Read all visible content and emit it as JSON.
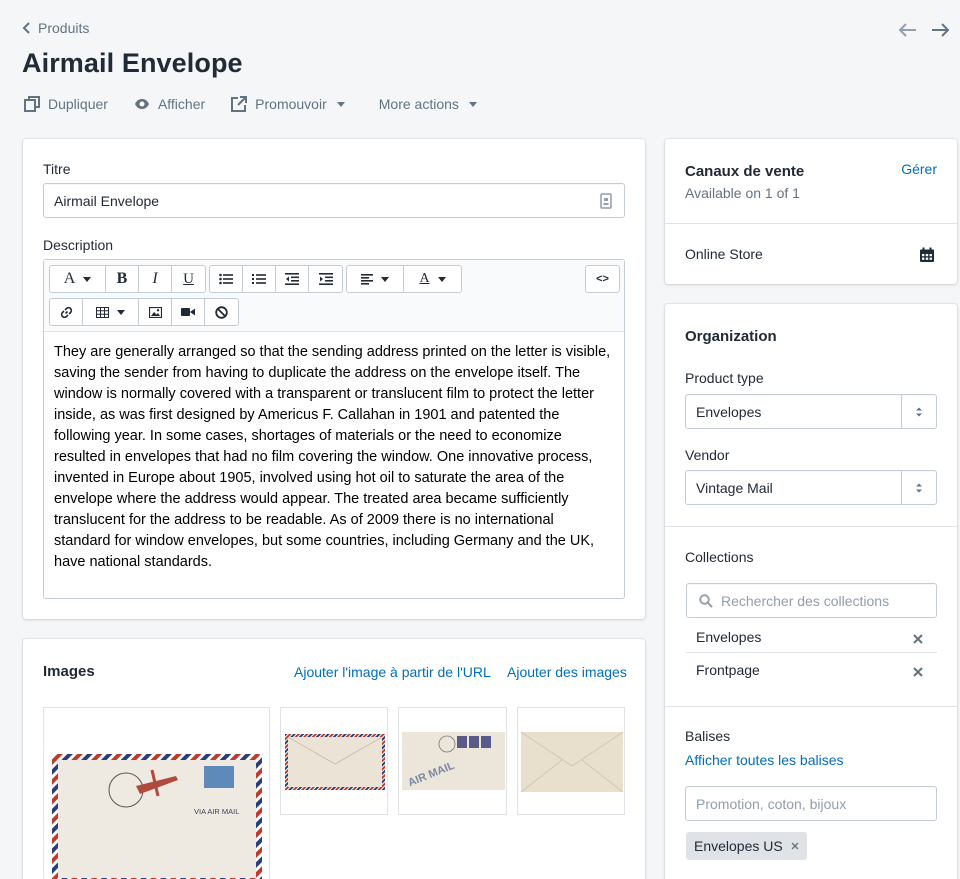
{
  "nav": {
    "back_label": "Produits",
    "prev": "previous-arrow-icon",
    "next": "next-arrow-icon"
  },
  "page_title": "Airmail Envelope",
  "actions": {
    "duplicate": "Dupliquer",
    "view": "Afficher",
    "promote": "Promouvoir",
    "more": "More actions"
  },
  "product": {
    "title_label": "Titre",
    "title_value": "Airmail Envelope",
    "description_label": "Description",
    "description_text": "They are generally arranged so that the sending address printed on the letter is visible, saving the sender from having to duplicate the address on the envelope itself. The window is normally covered with a transparent or translucent film to protect the letter inside, as was first designed by Americus F. Callahan in 1901 and patented the following year. In some cases, shortages of materials or the need to economize resulted in envelopes that had no film covering the window. One innovative process, invented in Europe about 1905, involved using hot oil to saturate the area of the envelope where the address would appear. The treated area became sufficiently translucent for the address to be readable. As of 2009 there is no international standard for window envelopes, but some countries, including Germany and the UK, have national standards.",
    "toolbar": {
      "font": "A",
      "bold": "B",
      "italic": "I",
      "underline": "U",
      "color": "A",
      "code": "<>"
    }
  },
  "images": {
    "heading": "Images",
    "add_from_url": "Ajouter l'image à partir de l'URL",
    "add_images": "Ajouter des images"
  },
  "sales_channels": {
    "heading": "Canaux de vente",
    "manage": "Gérer",
    "availability": "Available on 1 of 1",
    "channels": [
      {
        "name": "Online Store"
      }
    ]
  },
  "organization": {
    "heading": "Organization",
    "product_type_label": "Product type",
    "product_type_value": "Envelopes",
    "vendor_label": "Vendor",
    "vendor_value": "Vintage Mail",
    "collections_label": "Collections",
    "collections_placeholder": "Rechercher des collections",
    "collections": [
      {
        "name": "Envelopes"
      },
      {
        "name": "Frontpage"
      }
    ],
    "tags_label": "Balises",
    "show_all_tags": "Afficher toutes les balises",
    "tags_placeholder": "Promotion, coton, bijoux",
    "tags": [
      {
        "name": "Envelopes US"
      }
    ]
  },
  "colors": {
    "link": "#006fbb",
    "airmail_red": "#c0392b",
    "airmail_blue": "#2c3e7a"
  }
}
